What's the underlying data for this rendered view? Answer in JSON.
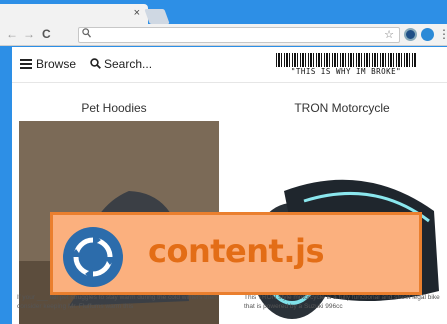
{
  "browser": {
    "tab_close": "×",
    "nav": {
      "back": "←",
      "forward": "→",
      "reload": "C"
    },
    "omnibox_icon": "search-icon",
    "star_icon": "star-icon"
  },
  "site": {
    "browse_label": "Browse",
    "search_label": "Search...",
    "logo_text": "\"THIS IS WHY IM BROKE\""
  },
  "products": [
    {
      "title": "Pet Hoodies",
      "description": "If your ___ fall pet struggles to stay warm during the cold winters then consider keeping Mr. Fluffums warm this"
    },
    {
      "title": "TRON Motorcycle",
      "description": "This TRON style motorcycle is a fully functional and street legal bike that is powered by a Suzuki 996cc"
    }
  ],
  "banner": {
    "text": "content.js",
    "icon": "refresh-cycle-icon"
  },
  "colors": {
    "desktop": "#2d8fe6",
    "banner_bg": "#fbb07e",
    "banner_border": "#ea7f2e",
    "banner_text": "#e36d16",
    "banner_icon": "#2c6cab"
  }
}
